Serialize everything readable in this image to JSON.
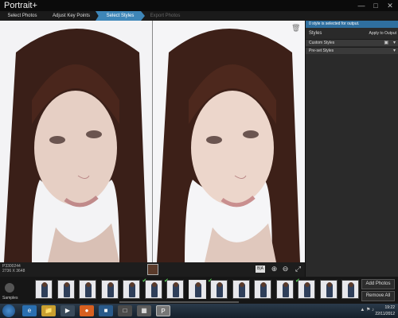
{
  "app": {
    "title": "Portrait+"
  },
  "window_controls": [
    "—",
    "□",
    "✕"
  ],
  "steps": [
    {
      "label": "Select Photos",
      "state": "normal"
    },
    {
      "label": "Adjust Key Points",
      "state": "normal"
    },
    {
      "label": "Select Styles",
      "state": "active"
    },
    {
      "label": "Export Photos",
      "state": "disabled"
    }
  ],
  "viewer": {
    "file_name": "P3300244",
    "dimensions": "2736 X 3648",
    "ba_label": "B|A"
  },
  "panel": {
    "info_text": "style is selected for output.",
    "info_count": "0",
    "styles_label": "Styles",
    "apply_label": "Apply to Output",
    "sections": [
      {
        "label": "Custom Styles"
      },
      {
        "label": "Pre-set Styles"
      }
    ]
  },
  "filmstrip": {
    "samples_label": "Samples",
    "add_button": "Add Photos",
    "remove_button": "Remove All",
    "thumbs": [
      {
        "checked": false,
        "selected": false
      },
      {
        "checked": false,
        "selected": false
      },
      {
        "checked": false,
        "selected": false
      },
      {
        "checked": false,
        "selected": false
      },
      {
        "checked": false,
        "selected": false
      },
      {
        "checked": true,
        "selected": false
      },
      {
        "checked": true,
        "selected": false
      },
      {
        "checked": false,
        "selected": true
      },
      {
        "checked": true,
        "selected": false
      },
      {
        "checked": false,
        "selected": false
      },
      {
        "checked": false,
        "selected": false
      },
      {
        "checked": false,
        "selected": false
      },
      {
        "checked": true,
        "selected": false
      },
      {
        "checked": false,
        "selected": false
      },
      {
        "checked": false,
        "selected": false
      }
    ]
  },
  "taskbar": {
    "time": "19:22",
    "date": "22/11/2012",
    "apps": [
      "IE",
      "Folder",
      "Media",
      "Firefox",
      "App1",
      "App2",
      "App3",
      "Portrait+"
    ],
    "tray_icons": "▲ ⚑ ♪"
  },
  "colors": {
    "accent": "#3e86b8",
    "check": "#5cd65c"
  }
}
